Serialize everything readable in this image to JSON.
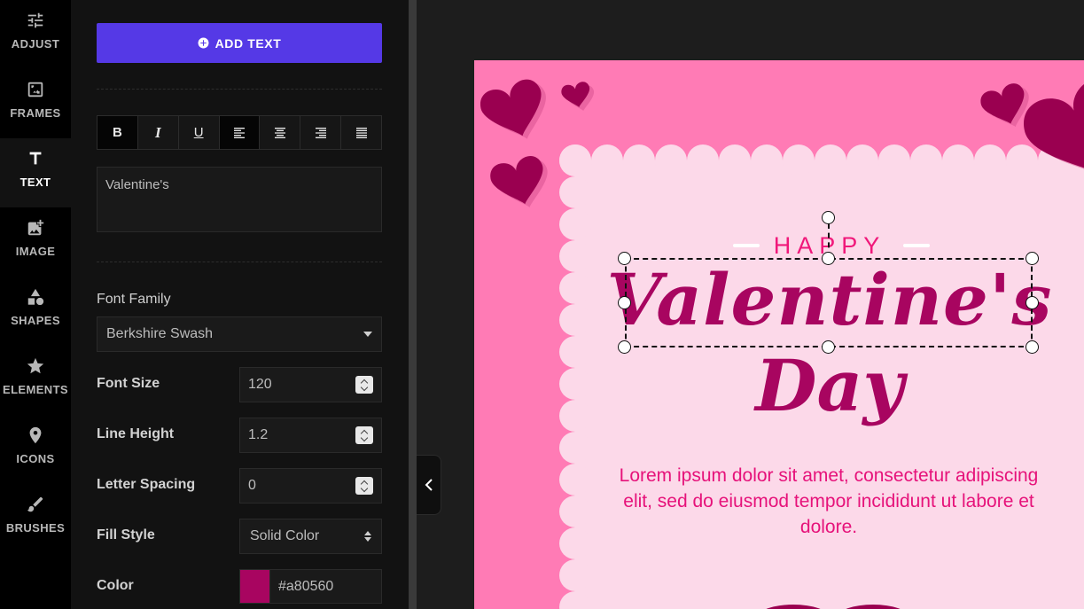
{
  "rail": {
    "items": [
      {
        "label": "ADJUST",
        "icon": "sliders-icon"
      },
      {
        "label": "FRAMES",
        "icon": "frame-icon"
      },
      {
        "label": "TEXT",
        "icon": "text-icon"
      },
      {
        "label": "IMAGE",
        "icon": "add-image-icon"
      },
      {
        "label": "SHAPES",
        "icon": "shapes-icon"
      },
      {
        "label": "ELEMENTS",
        "icon": "star-icon"
      },
      {
        "label": "ICONS",
        "icon": "map-pin-icon"
      },
      {
        "label": "BRUSHES",
        "icon": "brush-icon"
      }
    ],
    "active": "TEXT"
  },
  "panel": {
    "add_text_label": "ADD TEXT",
    "format": {
      "bold": "B",
      "italic": "I",
      "underline": "U"
    },
    "text_value": "Valentine's",
    "font_family_label": "Font Family",
    "font_family_value": "Berkshire Swash",
    "font_size_label": "Font Size",
    "font_size_value": "120",
    "line_height_label": "Line Height",
    "line_height_value": "1.2",
    "letter_spacing_label": "Letter Spacing",
    "letter_spacing_value": "0",
    "fill_style_label": "Fill Style",
    "fill_style_value": "Solid Color",
    "color_label": "Color",
    "color_value": "#a80560"
  },
  "canvas": {
    "happy": "HAPPY",
    "title": "Valentine's",
    "day": "Day",
    "body": "Lorem ipsum dolor sit amet, consectetur adipiscing elit, sed do eiusmod tempor incididunt ut labore et dolore."
  },
  "colors": {
    "accent": "#5539e6",
    "card_bg": "#ff7bb5",
    "inner_bg": "#fcd9e9",
    "title_color": "#a80560",
    "heart_color": "#9a0050",
    "subtitle_color": "#f0187a"
  }
}
